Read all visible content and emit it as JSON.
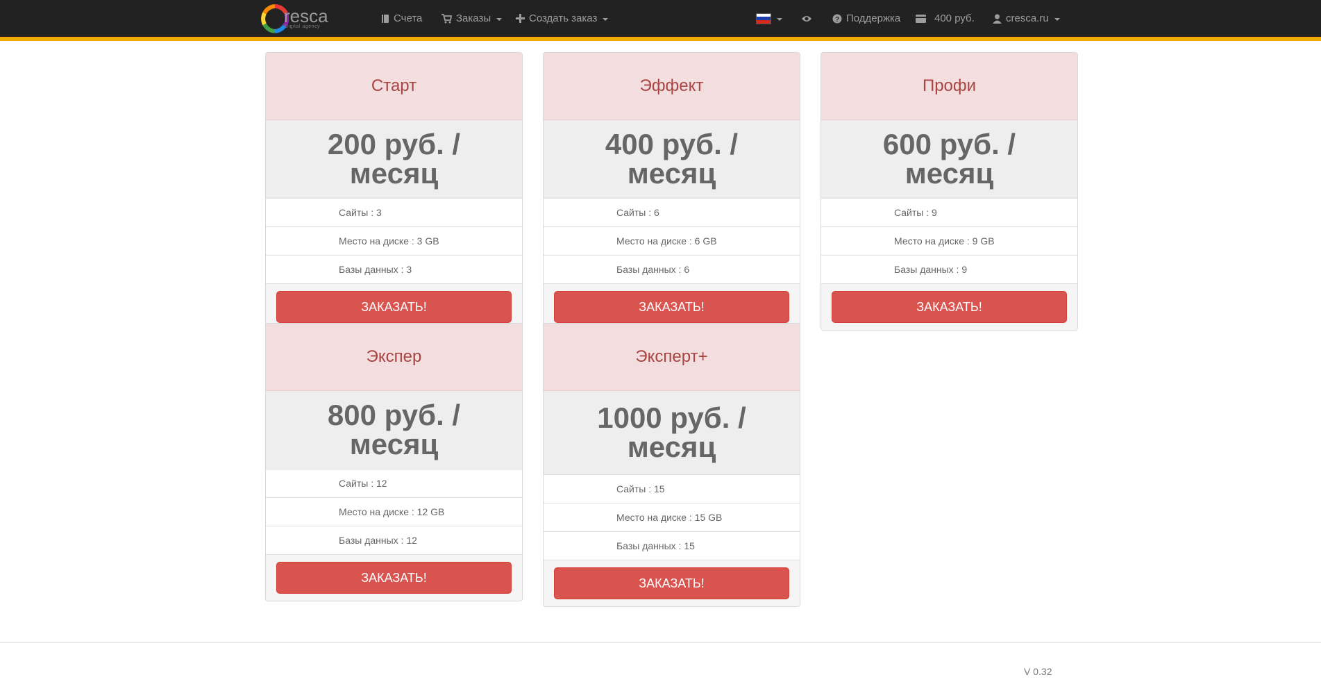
{
  "brand": {
    "name": "resca",
    "subtitle": "Digital agency"
  },
  "nav": {
    "invoices": "Счета",
    "orders": "Заказы",
    "create_order": "Создать заказ",
    "support": "Поддержка",
    "balance": "400 руб.",
    "account": "cresca.ru"
  },
  "colors": {
    "accent": "#f2a900",
    "danger": "#d9534f",
    "header_bg": "#222222",
    "card_head_bg": "#f2dede",
    "card_head_text": "#a94442"
  },
  "plans": [
    {
      "title": "Старт",
      "price": "200 руб. / месяц",
      "sites": "Сайты : 3",
      "disk": "Место на диске : 3 GB",
      "db": "Базы данных : 3",
      "button": "ЗАКАЗАТЬ!"
    },
    {
      "title": "Эффект",
      "price": "400 руб. / месяц",
      "sites": "Сайты : 6",
      "disk": "Место на диске : 6 GB",
      "db": "Базы данных : 6",
      "button": "ЗАКАЗАТЬ!"
    },
    {
      "title": "Профи",
      "price": "600 руб. / месяц",
      "sites": "Сайты : 9",
      "disk": "Место на диске : 9 GB",
      "db": "Базы данных : 9",
      "button": "ЗАКАЗАТЬ!"
    },
    {
      "title": "Экспер",
      "price": "800 руб. / месяц",
      "sites": "Сайты : 12",
      "disk": "Место на диске : 12 GB",
      "db": "Базы данных : 12",
      "button": "ЗАКАЗАТЬ!"
    },
    {
      "title": "Эксперт+",
      "price": "1000 руб. / месяц",
      "sites": "Сайты : 15",
      "disk": "Место на диске : 15 GB",
      "db": "Базы данных : 15",
      "button": "ЗАКАЗАТЬ!"
    }
  ],
  "footer": {
    "version": "V 0.32"
  }
}
